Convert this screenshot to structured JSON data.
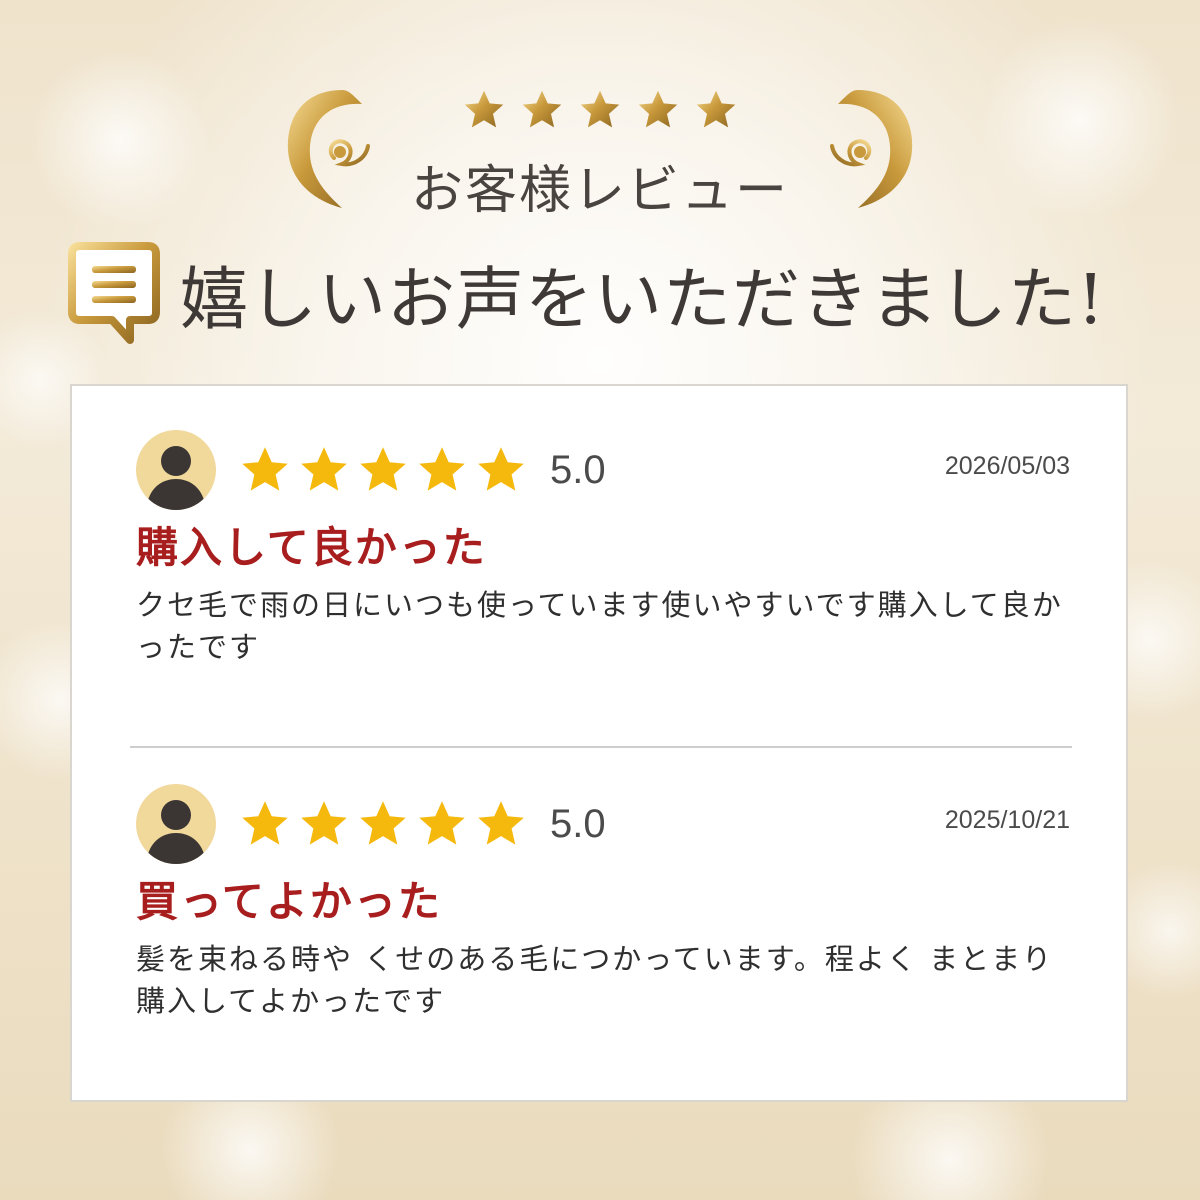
{
  "header": {
    "section_label": "お客様レビュー",
    "headline": "嬉しいお声をいただきました!",
    "star_color": "#d4a53c"
  },
  "reviews": [
    {
      "rating": "5.0",
      "rating_value": 5,
      "date": "2026/05/03",
      "title": "購入して良かった",
      "body": "クセ毛で雨の日にいつも使っています使いやすいです購入して良かったです"
    },
    {
      "rating": "5.0",
      "rating_value": 5,
      "date": "2025/10/21",
      "title": "買ってよかった",
      "body": "髪を束ねる時や くせのある毛につかっています。程よく まとまり購入してよかったです"
    }
  ],
  "icons": {
    "avatar": "user-avatar-icon",
    "star": "star-icon",
    "speech_bubble": "speech-bubble-icon"
  },
  "colors": {
    "review_title": "#a81d1d",
    "rating_star": "#f5b90e",
    "gold": "#c99a3c"
  }
}
